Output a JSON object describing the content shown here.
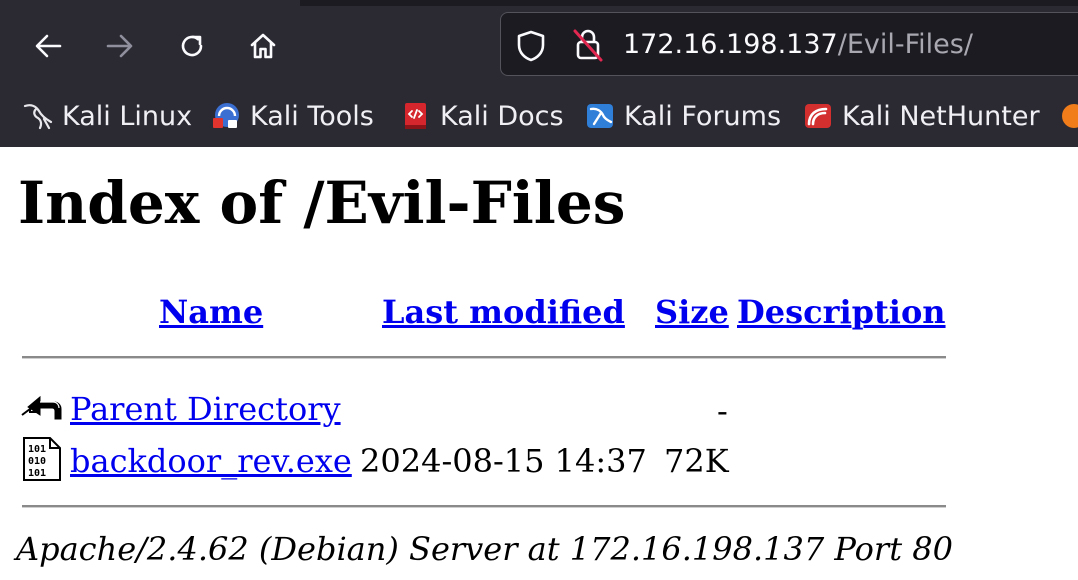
{
  "browser": {
    "url": {
      "host": "172.16.198.137",
      "path": "/Evil-Files/"
    },
    "toolbar_icons": [
      "back-arrow-icon",
      "forward-arrow-icon",
      "reload-icon",
      "home-icon",
      "shield-icon",
      "insecure-lock-icon"
    ],
    "bookmarks": [
      {
        "label": "Kali Linux",
        "icon": "kali-dragon-icon"
      },
      {
        "label": "Kali Tools",
        "icon": "kali-tools-icon"
      },
      {
        "label": "Kali Docs",
        "icon": "kali-docs-icon"
      },
      {
        "label": "Kali Forums",
        "icon": "kali-forums-icon"
      },
      {
        "label": "Kali NetHunter",
        "icon": "kali-nethunter-icon"
      }
    ]
  },
  "page": {
    "title": "Index of /Evil-Files",
    "columns": {
      "name": "Name",
      "last_modified": "Last modified",
      "size": "Size",
      "description": "Description"
    },
    "rows": [
      {
        "icon": "back-folder-icon",
        "name": "Parent Directory",
        "last_modified": "",
        "size": "-",
        "description": ""
      },
      {
        "icon": "binary-file-icon",
        "name": "backdoor_rev.exe",
        "last_modified": "2024-08-15 14:37",
        "size": "72K",
        "description": ""
      }
    ],
    "server_signature": "Apache/2.4.62 (Debian) Server at 172.16.198.137 Port 80"
  },
  "colors": {
    "chrome_bg": "#2b2a33",
    "urlbar_bg": "#1c1b22",
    "link": "#0000ee"
  }
}
